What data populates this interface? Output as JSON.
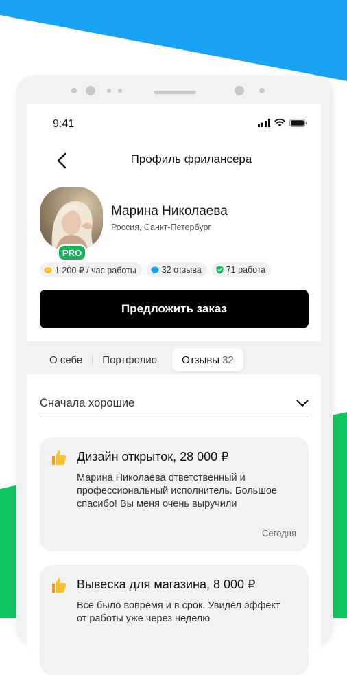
{
  "colors": {
    "accent_blue": "#1aa3f3",
    "accent_green": "#11c55f",
    "pro_badge": "#18b45c",
    "cta_bg": "#000000"
  },
  "status_bar": {
    "time": "9:41",
    "icons": [
      "signal-icon",
      "wifi-icon",
      "battery-icon"
    ]
  },
  "header": {
    "back_icon": "chevron-left-icon",
    "title": "Профиль фрилансера"
  },
  "profile": {
    "name": "Марина Николаева",
    "location": "Россия, Санкт-Петербург",
    "badge": "PRO",
    "stats": [
      {
        "icon": "coin-icon",
        "label": "1 200 ₽ / час работы"
      },
      {
        "icon": "chat-bubble-icon",
        "label": "32 отзыва"
      },
      {
        "icon": "shield-check-icon",
        "label": "71 работа"
      }
    ]
  },
  "cta": {
    "label": "Предложить заказ"
  },
  "tabs": [
    {
      "label": "О себе"
    },
    {
      "label": "Портфолио"
    },
    {
      "label": "Отзывы",
      "count": "32",
      "active": true
    }
  ],
  "sort": {
    "label": "Сначала хорошие",
    "icon": "chevron-down-icon"
  },
  "reviews": [
    {
      "icon": "thumbs-up-icon",
      "title": "Дизайн открыток, 28 000 ₽",
      "text": "Марина Николаева ответственный и профессиональный исполнитель. Большое спасибо! Вы меня очень выручили",
      "date": "Сегодня"
    },
    {
      "icon": "thumbs-up-icon",
      "title": "Вывеска для магазина, 8 000 ₽",
      "text": "Все было вовремя и в срок. Увидел эффект от работы уже через неделю",
      "date": ""
    }
  ]
}
